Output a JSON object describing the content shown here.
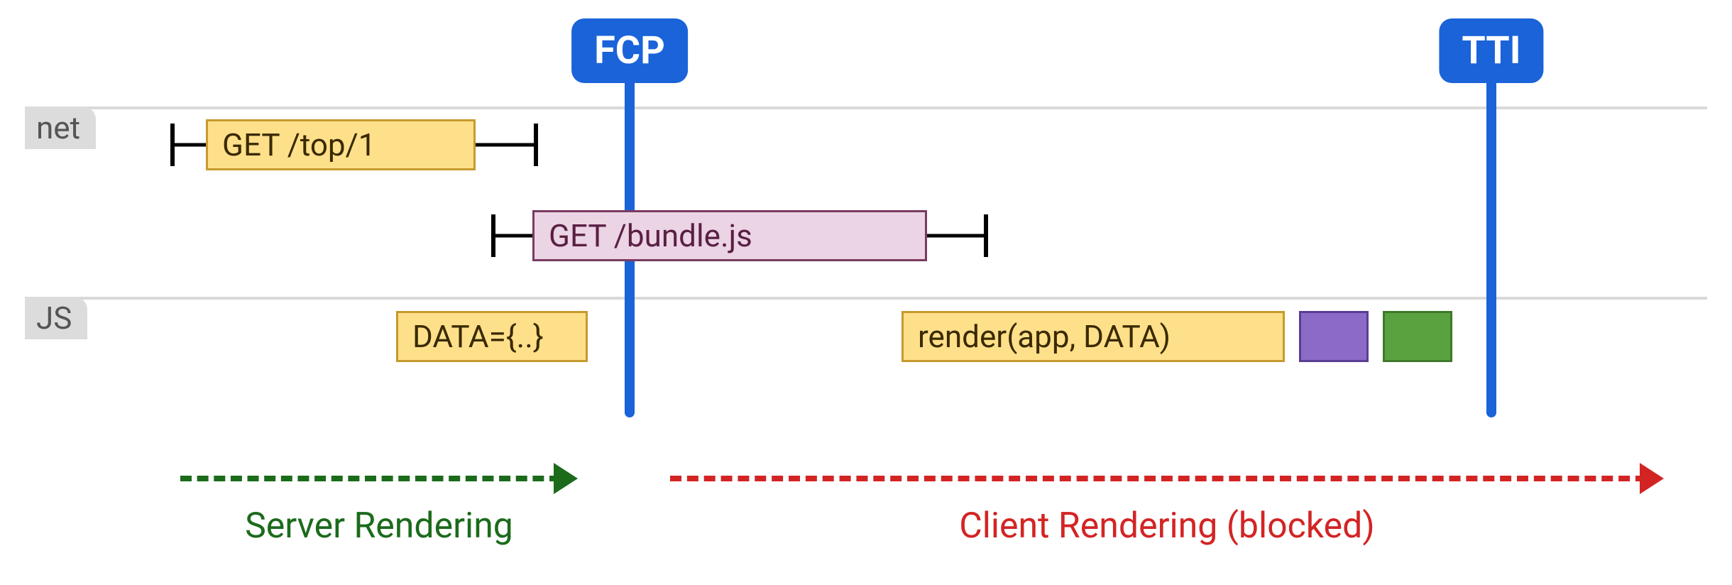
{
  "lanes": {
    "net": "net",
    "js": "JS"
  },
  "metrics": {
    "fcp": "FCP",
    "tti": "TTI"
  },
  "bars": {
    "get_top": "GET /top/1",
    "get_bundle": "GET /bundle.js",
    "data_block": "DATA={..}",
    "render_call": "render(app, DATA)"
  },
  "phases": {
    "server": "Server Rendering",
    "client": "Client Rendering (blocked)"
  }
}
